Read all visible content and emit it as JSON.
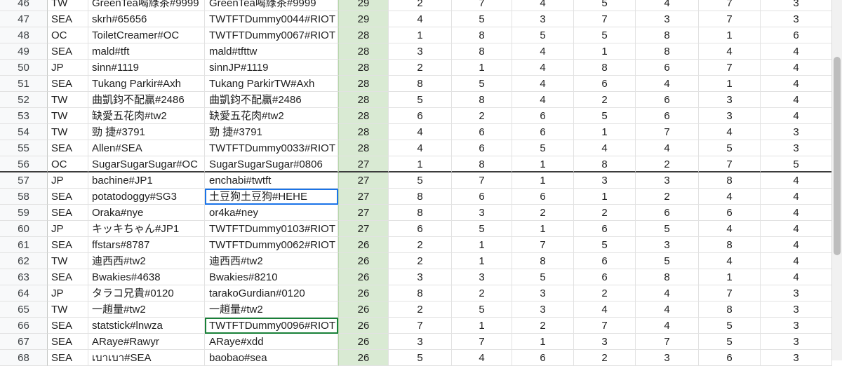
{
  "rows": [
    {
      "n": "46",
      "region": "TW",
      "riot": "GreenTea喝綠茶#9999",
      "alt": "GreenTea喝綠茶#9999",
      "score": "29",
      "vals": [
        "2",
        "7",
        "4",
        "5",
        "4",
        "7",
        "3"
      ]
    },
    {
      "n": "47",
      "region": "SEA",
      "riot": "skrh#65656",
      "alt": "TWTFTDummy0044#RIOT",
      "score": "29",
      "vals": [
        "4",
        "5",
        "3",
        "7",
        "3",
        "7",
        "3"
      ]
    },
    {
      "n": "48",
      "region": "OC",
      "riot": "ToiletCreamer#OC",
      "alt": "TWTFTDummy0067#RIOT",
      "score": "28",
      "vals": [
        "1",
        "8",
        "5",
        "5",
        "8",
        "1",
        "6"
      ]
    },
    {
      "n": "49",
      "region": "SEA",
      "riot": "mald#tft",
      "alt": "mald#tfttw",
      "score": "28",
      "vals": [
        "3",
        "8",
        "4",
        "1",
        "8",
        "4",
        "4"
      ]
    },
    {
      "n": "50",
      "region": "JP",
      "riot": "sinn#1119",
      "alt": "sinnJP#1119",
      "score": "28",
      "vals": [
        "2",
        "1",
        "4",
        "8",
        "6",
        "7",
        "4"
      ]
    },
    {
      "n": "51",
      "region": "SEA",
      "riot": "Tukang Parkir#Axh",
      "alt": "Tukang ParkirTW#Axh",
      "score": "28",
      "vals": [
        "8",
        "5",
        "4",
        "6",
        "4",
        "1",
        "4"
      ]
    },
    {
      "n": "52",
      "region": "TW",
      "riot": "曲凱鈞不配贏#2486",
      "alt": "曲凱鈞不配贏#2486",
      "score": "28",
      "vals": [
        "5",
        "8",
        "4",
        "2",
        "6",
        "3",
        "4"
      ]
    },
    {
      "n": "53",
      "region": "TW",
      "riot": "缺愛五花肉#tw2",
      "alt": "缺愛五花肉#tw2",
      "score": "28",
      "vals": [
        "6",
        "2",
        "6",
        "5",
        "6",
        "3",
        "4"
      ]
    },
    {
      "n": "54",
      "region": "TW",
      "riot": "勁 捷#3791",
      "alt": "勁 捷#3791",
      "score": "28",
      "vals": [
        "4",
        "6",
        "6",
        "1",
        "7",
        "4",
        "3"
      ]
    },
    {
      "n": "55",
      "region": "SEA",
      "riot": "Allen#SEA",
      "alt": "TWTFTDummy0033#RIOT",
      "score": "28",
      "vals": [
        "4",
        "6",
        "5",
        "4",
        "4",
        "5",
        "3"
      ]
    },
    {
      "n": "56",
      "region": "OC",
      "riot": "SugarSugarSugar#OC",
      "alt": "SugarSugarSugar#0806",
      "score": "27",
      "vals": [
        "1",
        "8",
        "1",
        "8",
        "2",
        "7",
        "5"
      ],
      "thick": true
    },
    {
      "n": "57",
      "region": "JP",
      "riot": "bachine#JP1",
      "alt": "enchabi#twtft",
      "score": "27",
      "vals": [
        "5",
        "7",
        "1",
        "3",
        "3",
        "8",
        "4"
      ]
    },
    {
      "n": "58",
      "region": "SEA",
      "riot": "potatodoggy#SG3",
      "alt": "土豆狗土豆狗#HEHE",
      "score": "27",
      "vals": [
        "8",
        "6",
        "6",
        "1",
        "2",
        "4",
        "4"
      ],
      "sel": "blue"
    },
    {
      "n": "59",
      "region": "SEA",
      "riot": "Oraka#nye",
      "alt": "or4ka#ney",
      "score": "27",
      "vals": [
        "8",
        "3",
        "2",
        "2",
        "6",
        "6",
        "4"
      ]
    },
    {
      "n": "60",
      "region": "JP",
      "riot": "キッキちゃん#JP1",
      "alt": "TWTFTDummy0103#RIOT",
      "score": "27",
      "vals": [
        "6",
        "5",
        "1",
        "6",
        "5",
        "4",
        "4"
      ]
    },
    {
      "n": "61",
      "region": "SEA",
      "riot": "ffstars#8787",
      "alt": "TWTFTDummy0062#RIOT",
      "score": "26",
      "vals": [
        "2",
        "1",
        "7",
        "5",
        "3",
        "8",
        "4"
      ]
    },
    {
      "n": "62",
      "region": "TW",
      "riot": "迪西西#tw2",
      "alt": "迪西西#tw2",
      "score": "26",
      "vals": [
        "2",
        "1",
        "8",
        "6",
        "5",
        "4",
        "4"
      ]
    },
    {
      "n": "63",
      "region": "SEA",
      "riot": "Bwakies#4638",
      "alt": "Bwakies#8210",
      "score": "26",
      "vals": [
        "3",
        "3",
        "5",
        "6",
        "8",
        "1",
        "4"
      ]
    },
    {
      "n": "64",
      "region": "JP",
      "riot": "タラコ兄貴#0120",
      "alt": "tarakoGurdian#0120",
      "score": "26",
      "vals": [
        "8",
        "2",
        "3",
        "2",
        "4",
        "7",
        "3"
      ]
    },
    {
      "n": "65",
      "region": "TW",
      "riot": "一趙量#tw2",
      "alt": "一趙量#tw2",
      "score": "26",
      "vals": [
        "2",
        "5",
        "3",
        "4",
        "4",
        "8",
        "3"
      ]
    },
    {
      "n": "66",
      "region": "SEA",
      "riot": "statstick#lnwza",
      "alt": "TWTFTDummy0096#RIOT",
      "score": "26",
      "vals": [
        "7",
        "1",
        "2",
        "7",
        "4",
        "5",
        "3"
      ],
      "sel": "green"
    },
    {
      "n": "67",
      "region": "SEA",
      "riot": "ARaye#Rawyr",
      "alt": "ARaye#xdd",
      "score": "26",
      "vals": [
        "3",
        "7",
        "1",
        "3",
        "7",
        "5",
        "3"
      ]
    },
    {
      "n": "68",
      "region": "SEA",
      "riot": "เบาเบา#SEA",
      "alt": "baobao#sea",
      "score": "26",
      "vals": [
        "5",
        "4",
        "6",
        "2",
        "3",
        "6",
        "3"
      ]
    }
  ],
  "scrollbar": {
    "position": 0.35,
    "visible_fraction": 0.55
  }
}
